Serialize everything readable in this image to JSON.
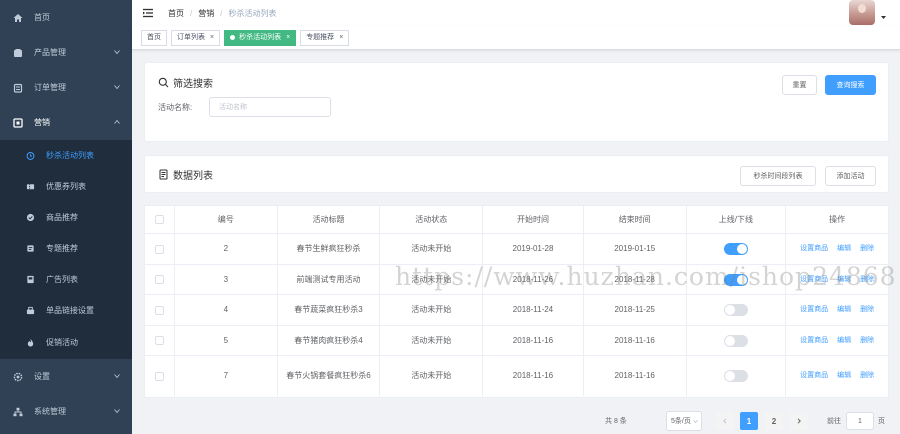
{
  "sidebar": {
    "items": [
      {
        "label": "首页",
        "icon": "home-icon"
      },
      {
        "label": "产品管理",
        "icon": "product-icon"
      },
      {
        "label": "订单管理",
        "icon": "order-icon"
      },
      {
        "label": "营销",
        "icon": "marketing-icon"
      }
    ],
    "sub_items": [
      {
        "label": "秒杀活动列表",
        "icon": "clock-icon"
      },
      {
        "label": "优惠券列表",
        "icon": "coupon-icon"
      },
      {
        "label": "商品推荐",
        "icon": "recommend-icon"
      },
      {
        "label": "专题推荐",
        "icon": "topic-icon"
      },
      {
        "label": "广告列表",
        "icon": "ad-icon"
      },
      {
        "label": "单品链接设置",
        "icon": "link-icon"
      },
      {
        "label": "促销活动",
        "icon": "fire-icon"
      }
    ],
    "bottom_items": [
      {
        "label": "设置",
        "icon": "settings-icon"
      },
      {
        "label": "系统管理",
        "icon": "system-icon"
      }
    ],
    "bg_color": "#304156",
    "active_color": "#409eff"
  },
  "breadcrumb": [
    "首页",
    "营销",
    "秒杀活动列表"
  ],
  "tags": [
    "首页",
    "订单列表",
    "秒杀活动列表",
    "专题推荐"
  ],
  "filter": {
    "title": "筛选搜索",
    "reset_label": "重置",
    "search_label": "查询搜索",
    "field_label": "活动名称:",
    "field_placeholder": "活动名称"
  },
  "list": {
    "title": "数据列表",
    "session_label": "秒杀时间段列表",
    "add_label": "添加活动"
  },
  "table": {
    "columns": [
      "编号",
      "活动标题",
      "活动状态",
      "开始时间",
      "结束时间",
      "上线/下线",
      "操作"
    ],
    "rows": [
      {
        "id": "2",
        "title": "春节生鲜疯狂秒杀",
        "status": "活动未开始",
        "start": "2019-01-28",
        "end": "2019-01-15",
        "online": true
      },
      {
        "id": "3",
        "title": "前端测试专用活动",
        "status": "活动未开始",
        "start": "2018-11-26",
        "end": "2018-11-28",
        "online": true
      },
      {
        "id": "4",
        "title": "春节蔬菜疯狂秒杀3",
        "status": "活动未开始",
        "start": "2018-11-24",
        "end": "2018-11-25",
        "online": false
      },
      {
        "id": "5",
        "title": "春节猪肉疯狂秒杀4",
        "status": "活动未开始",
        "start": "2018-11-16",
        "end": "2018-11-16",
        "online": false
      },
      {
        "id": "7",
        "title": "春节火锅套餐疯狂秒杀6",
        "status": "活动未开始",
        "start": "2018-11-16",
        "end": "2018-11-16",
        "online": false
      }
    ],
    "ops": [
      "设置商品",
      "编辑",
      "删除"
    ],
    "switch_on_color": "#409eff"
  },
  "pagination": {
    "total_label": "共 8 条",
    "page_size": "5条/页",
    "pages": [
      "1",
      "2"
    ],
    "goto_label": "前往",
    "goto_value": "1",
    "page_unit": "页"
  },
  "watermark": "https://www.huzhan.com/ishop24868"
}
